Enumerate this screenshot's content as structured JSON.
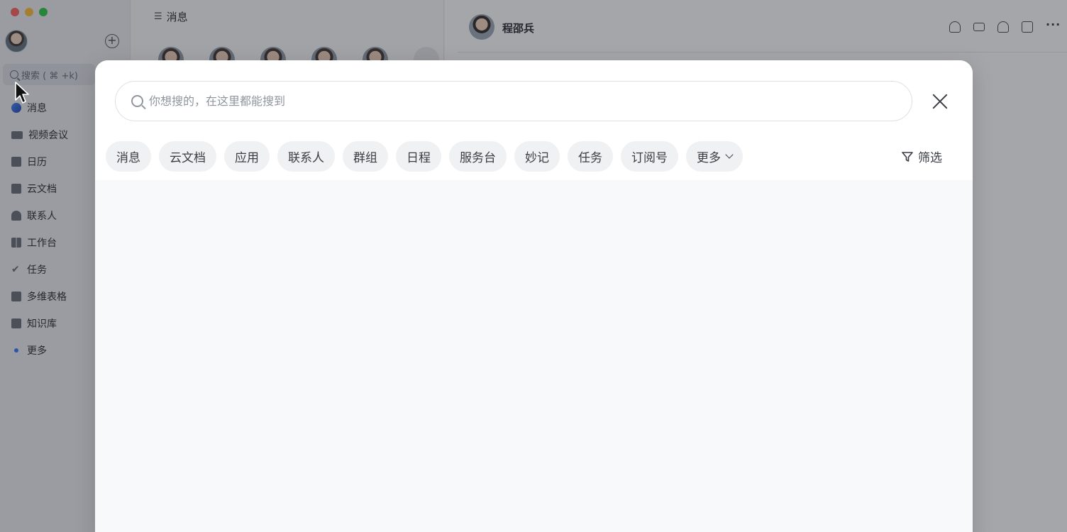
{
  "sidebar": {
    "search_label": "搜索 ( ⌘ +k)",
    "items": [
      {
        "label": "消息",
        "icon": "message-icon"
      },
      {
        "label": "视频会议",
        "icon": "video-icon"
      },
      {
        "label": "日历",
        "icon": "calendar-icon"
      },
      {
        "label": "云文档",
        "icon": "doc-icon"
      },
      {
        "label": "联系人",
        "icon": "contact-icon"
      },
      {
        "label": "工作台",
        "icon": "workplace-icon"
      },
      {
        "label": "任务",
        "icon": "task-icon"
      },
      {
        "label": "多维表格",
        "icon": "base-icon"
      },
      {
        "label": "知识库",
        "icon": "wiki-icon"
      },
      {
        "label": "更多",
        "icon": "more-icon"
      }
    ]
  },
  "chatlist": {
    "title": "消息"
  },
  "chat": {
    "contact_name": "程邵兵"
  },
  "modal": {
    "search_placeholder": "你想搜的，在这里都能搜到",
    "search_value": "",
    "filters": [
      "消息",
      "云文档",
      "应用",
      "联系人",
      "群组",
      "日程",
      "服务台",
      "妙记",
      "任务",
      "订阅号"
    ],
    "more_label": "更多",
    "filter_label": "筛选"
  },
  "colors": {
    "accent": "#3370ff",
    "overlay": "#282c34"
  }
}
